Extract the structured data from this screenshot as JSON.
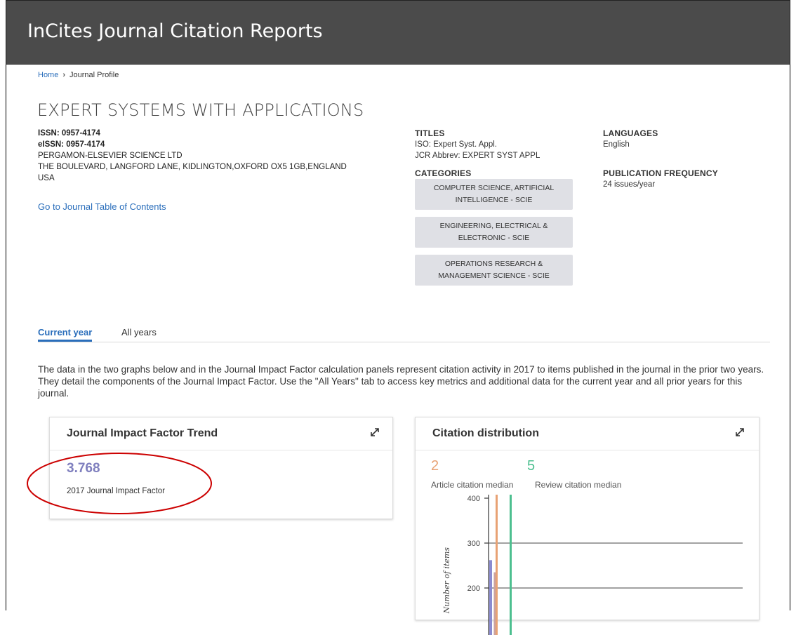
{
  "app": {
    "title": "InCites Journal Citation Reports"
  },
  "breadcrumb": {
    "home": "Home",
    "separator": "›",
    "current": "Journal Profile"
  },
  "journal": {
    "name": "EXPERT SYSTEMS WITH APPLICATIONS",
    "issn": "ISSN: 0957-4174",
    "eissn": "eISSN: 0957-4174",
    "publisher": "PERGAMON-ELSEVIER SCIENCE LTD",
    "address": "THE BOULEVARD, LANGFORD LANE, KIDLINGTON,OXFORD OX5 1GB,ENGLAND",
    "country": "USA",
    "toc_link": "Go to Journal Table of Contents"
  },
  "titles": {
    "heading": "TITLES",
    "iso": "ISO: Expert Syst. Appl.",
    "jcr_abbrev": "JCR Abbrev: EXPERT SYST APPL"
  },
  "categories": {
    "heading": "CATEGORIES",
    "items": [
      {
        "label": "COMPUTER SCIENCE, ARTIFICIAL INTELLIGENCE - SCIE"
      },
      {
        "label": "ENGINEERING, ELECTRICAL & ELECTRONIC - SCIE"
      },
      {
        "label": "OPERATIONS RESEARCH & MANAGEMENT SCIENCE - SCIE"
      }
    ]
  },
  "languages": {
    "heading": "LANGUAGES",
    "value": "English"
  },
  "frequency": {
    "heading": "PUBLICATION FREQUENCY",
    "value": "24 issues/year"
  },
  "tabs": [
    {
      "label": "Current year",
      "active": true
    },
    {
      "label": "All years",
      "active": false
    }
  ],
  "description": "The data in the two graphs below and in the Journal Impact Factor calculation panels represent citation activity in 2017 to items published in the journal in the prior two years. They detail the components of the Journal Impact Factor. Use the \"All Years\" tab to access key metrics and additional data for the current year and all prior years for this journal.",
  "jif_card": {
    "title": "Journal Impact Factor Trend",
    "value": "3.768",
    "label": "2017 Journal Impact Factor",
    "value_color": "#7f7fbe"
  },
  "citation_card": {
    "title": "Citation distribution",
    "article_median": "2",
    "article_label": "Article citation median",
    "article_color": "#e8a274",
    "review_median": "5",
    "review_label": "Review citation median",
    "review_color": "#4cbf8f"
  },
  "chart_data": {
    "type": "bar",
    "ylabel": "Number of items",
    "ylim": [
      0,
      400
    ],
    "ticks": [
      "400",
      "300",
      "200"
    ],
    "gridlines": [
      400,
      300,
      200
    ],
    "medians": [
      {
        "name": "Article citation median",
        "x": 2,
        "color": "#e8a274"
      },
      {
        "name": "Review citation median",
        "x": 5,
        "color": "#4cbf8f"
      }
    ],
    "series": [
      {
        "color": "#8b8bd0",
        "values": [
          262
        ]
      },
      {
        "color": "#c9a3a3",
        "values": [
          235
        ]
      }
    ]
  },
  "colors": {
    "header_bg": "#4b4b4b",
    "link": "#2a6ebb",
    "chip_bg": "#dfe0e5",
    "annotation": "#cc0000"
  }
}
